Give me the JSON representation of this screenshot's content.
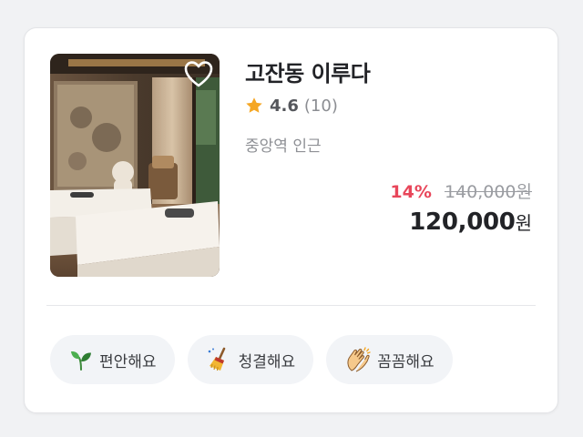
{
  "listing": {
    "title": "고잔동 이루다",
    "rating": "4.6",
    "review_count": "(10)",
    "location": "중앙역 인근",
    "favorited": false
  },
  "pricing": {
    "discount": "14%",
    "original_price": "140,000원",
    "price": "120,000",
    "currency": "원"
  },
  "tags": [
    {
      "label": "편안해요",
      "icon": "seedling-icon"
    },
    {
      "label": "청결해요",
      "icon": "broom-icon"
    },
    {
      "label": "꼼꼼해요",
      "icon": "clapping-hands-icon"
    }
  ],
  "colors": {
    "discount": "#e8465a",
    "star": "#f5a623",
    "tag_bg": "#f2f4f7"
  }
}
